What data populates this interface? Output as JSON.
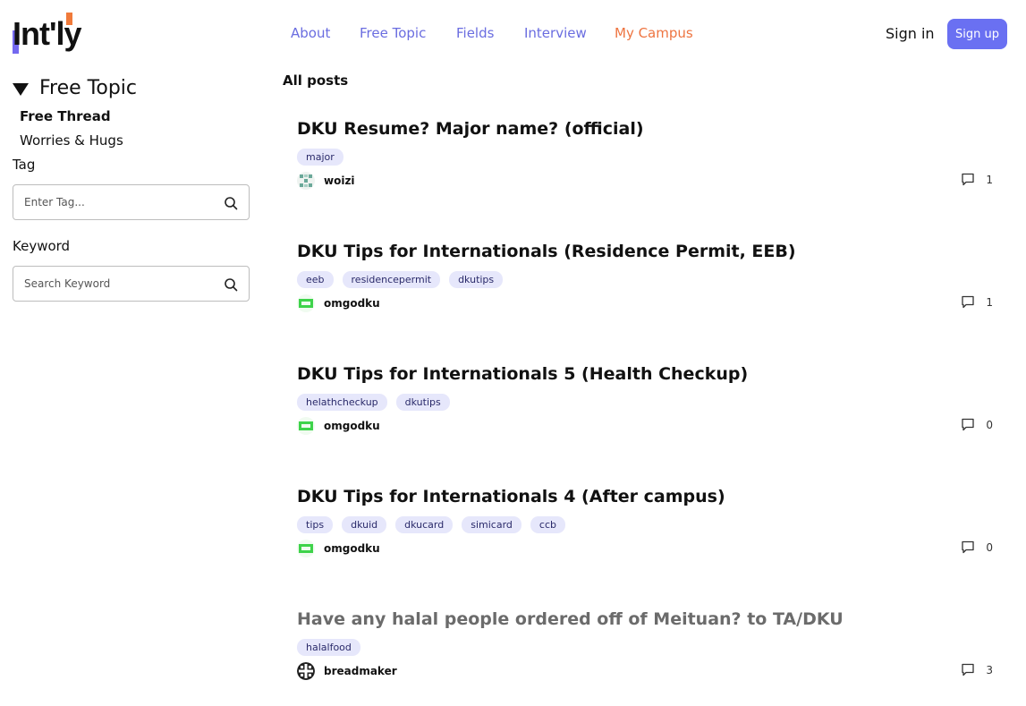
{
  "header": {
    "logo_text": "Int'ly",
    "nav": [
      {
        "label": "About"
      },
      {
        "label": "Free Topic"
      },
      {
        "label": "Fields"
      },
      {
        "label": "Interview"
      },
      {
        "label": "My Campus",
        "active": true
      }
    ],
    "signin_label": "Sign in",
    "signup_label": "Sign up"
  },
  "colors": {
    "accent": "#6a70f2",
    "nav_link": "#6a6de0",
    "nav_active": "#ee7440",
    "tag_bg": "#e6e7fb"
  },
  "sidebar": {
    "section_title": "Free Topic",
    "items": [
      {
        "label": "Free Thread",
        "selected": true
      },
      {
        "label": "Worries & Hugs"
      }
    ],
    "tag_label": "Tag",
    "tag_placeholder": "Enter Tag...",
    "keyword_label": "Keyword",
    "keyword_placeholder": "Search Keyword"
  },
  "main": {
    "heading": "All posts",
    "posts": [
      {
        "title": "DKU Resume? Major name? (official)",
        "tags": [
          "major"
        ],
        "author": "woizi",
        "comments": "1"
      },
      {
        "title": "DKU Tips for Internationals (Residence Permit, EEB)",
        "tags": [
          "eeb",
          "residencepermit",
          "dkutips"
        ],
        "author": "omgodku",
        "comments": "1"
      },
      {
        "title": "DKU Tips for Internationals 5 (Health Checkup)",
        "tags": [
          "helathcheckup",
          "dkutips"
        ],
        "author": "omgodku",
        "comments": "0"
      },
      {
        "title": "DKU Tips for Internationals 4 (After campus)",
        "tags": [
          "tips",
          "dkuid",
          "dkucard",
          "simicard",
          "ccb"
        ],
        "author": "omgodku",
        "comments": "0"
      },
      {
        "title": "Have any halal people ordered off of Meituan? to TA/DKU",
        "tags": [
          "halalfood"
        ],
        "author": "breadmaker",
        "comments": "3"
      }
    ]
  }
}
